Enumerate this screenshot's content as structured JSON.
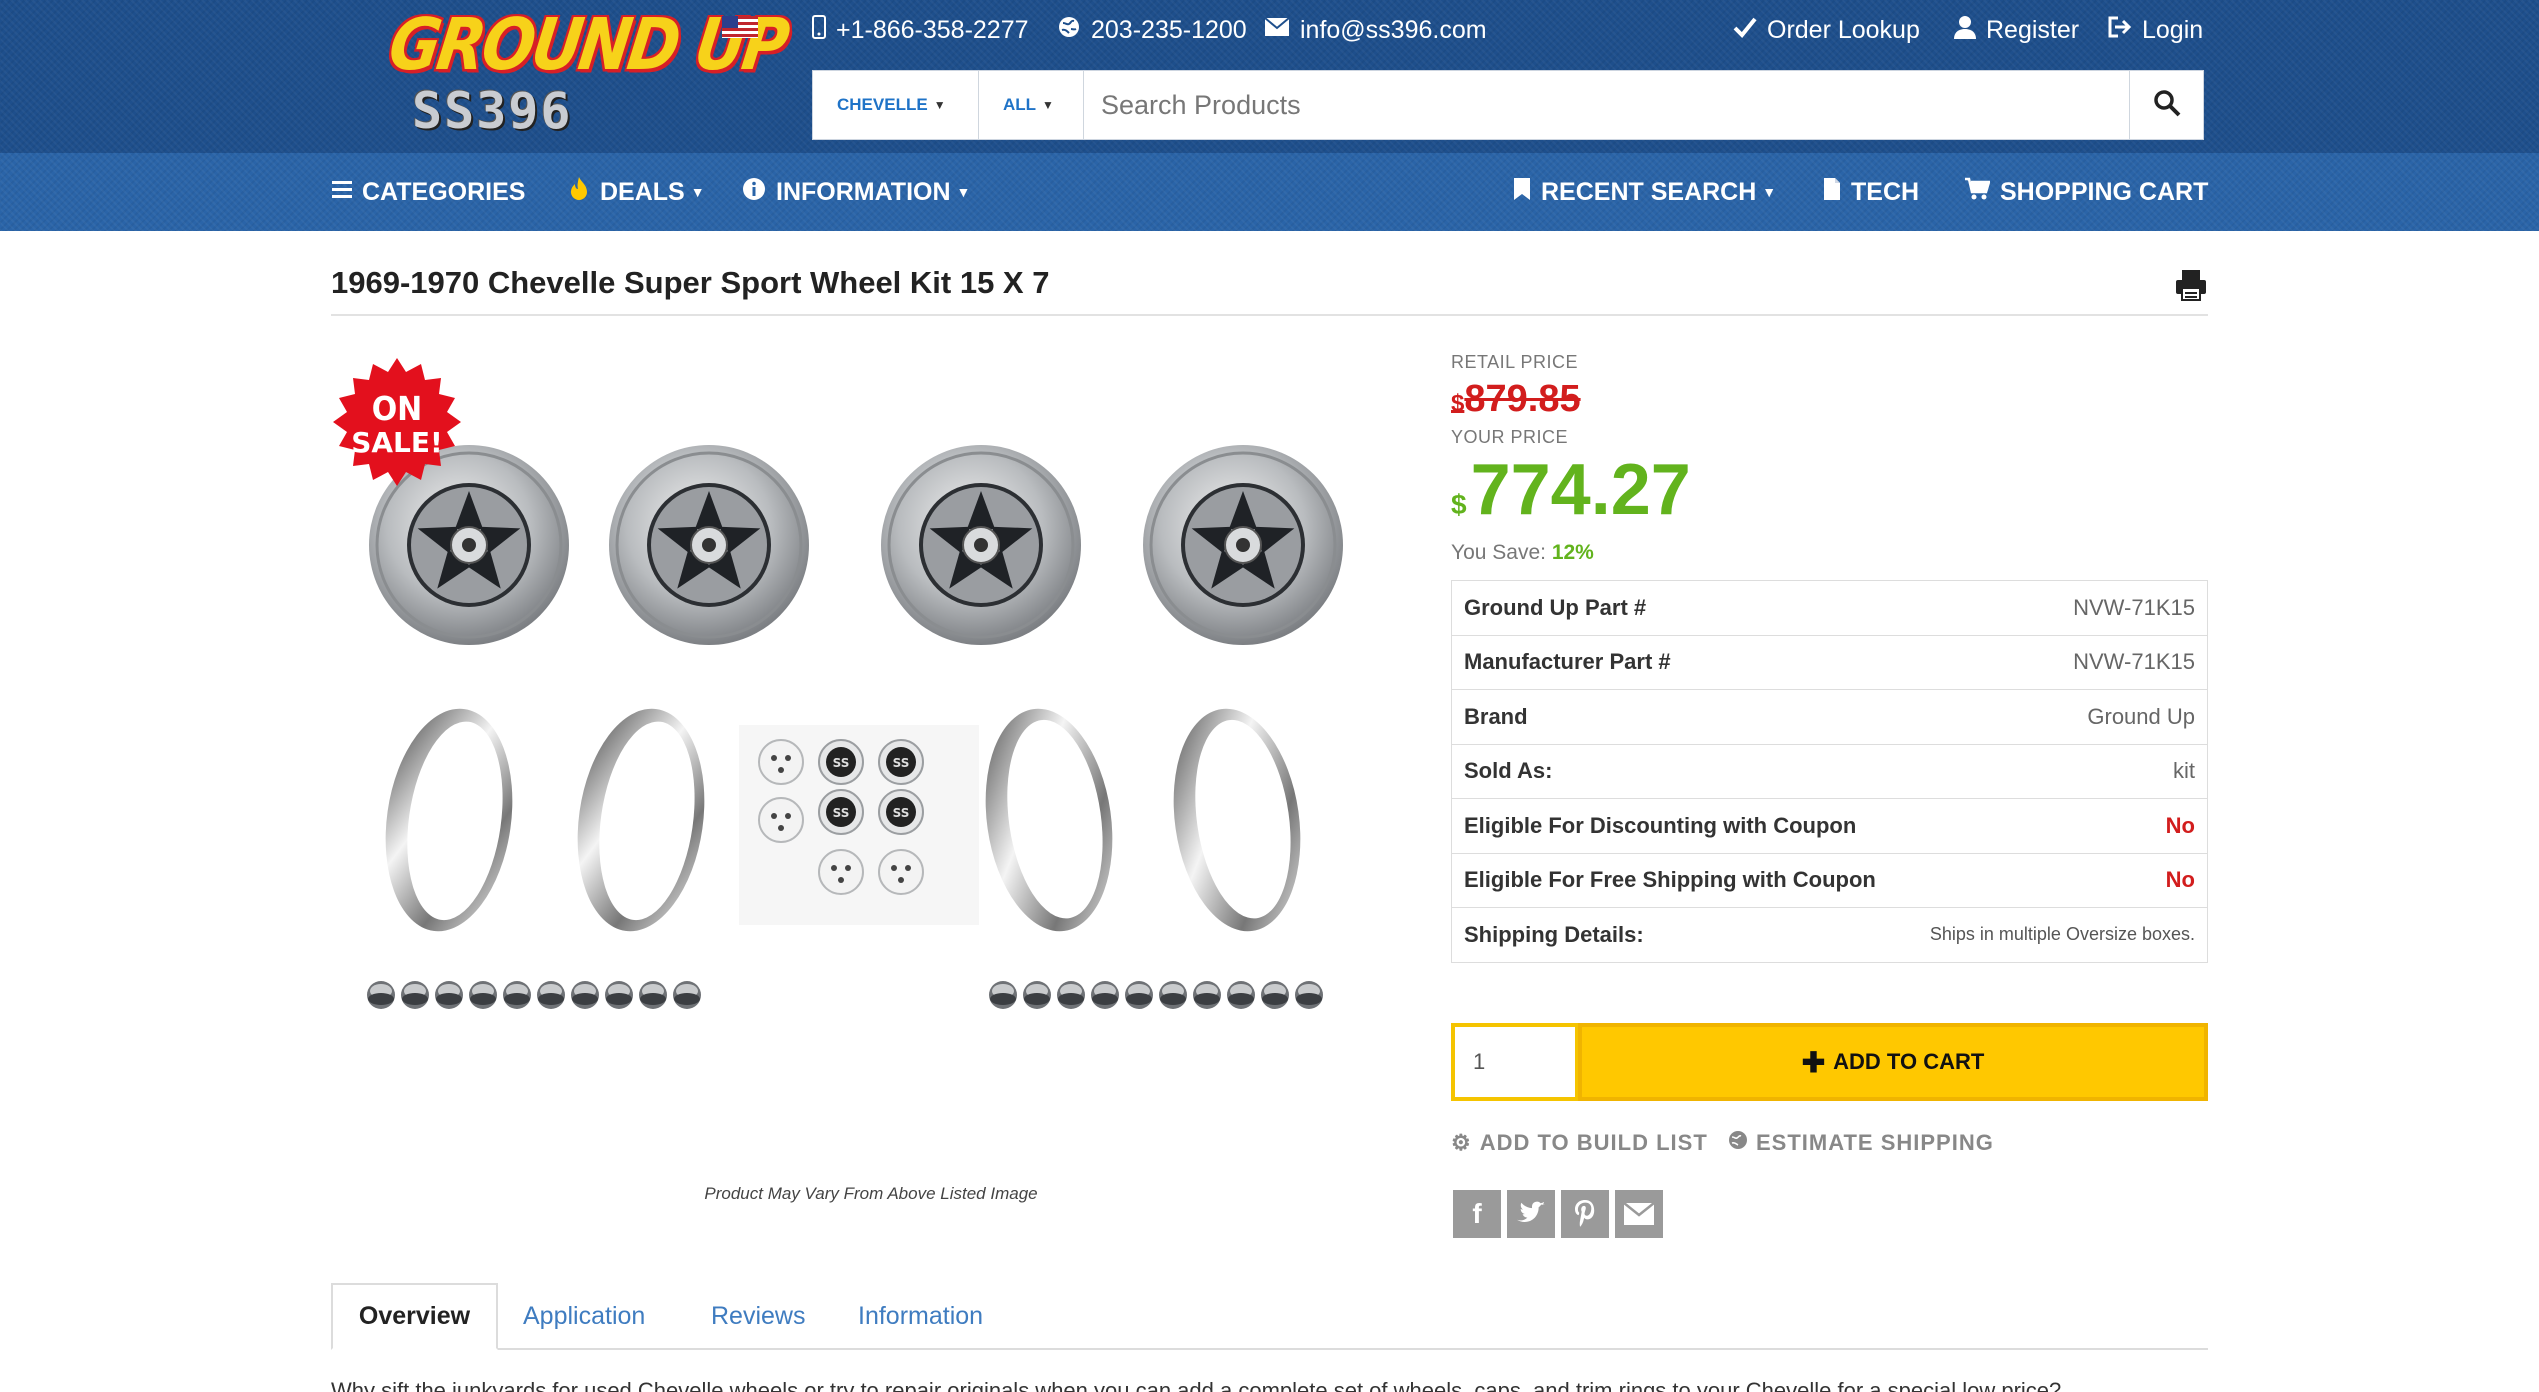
{
  "header": {
    "logo_top": "GROUND UP",
    "logo_bottom": "SS396",
    "phone1": "+1-866-358-2277",
    "phone2": "203-235-1200",
    "email": "info@ss396.com",
    "order_lookup": "Order Lookup",
    "register": "Register",
    "login": "Login"
  },
  "search": {
    "make_label": "CHEVELLE",
    "category_label": "ALL",
    "placeholder": "Search Products"
  },
  "nav": {
    "categories": "CATEGORIES",
    "deals": "DEALS",
    "information": "INFORMATION",
    "recent_search": "RECENT SEARCH",
    "tech": "TECH",
    "shopping_cart": "SHOPPING CART"
  },
  "product": {
    "title": "1969-1970 Chevelle Super Sport Wheel Kit 15 X 7",
    "sale_badge": [
      "ON",
      "SALE!"
    ],
    "image_caption": "Product May Vary From Above Listed Image",
    "retail_label": "RETAIL PRICE",
    "currency_symbol": "$",
    "retail_price": "879.85",
    "your_label": "YOUR PRICE",
    "your_price": "774.27",
    "you_save_label": "You Save:",
    "you_save_value": "12%",
    "center_cap_text": "SS"
  },
  "specs": [
    {
      "key": "Ground Up Part #",
      "value": "NVW-71K15"
    },
    {
      "key": "Manufacturer Part #",
      "value": "NVW-71K15"
    },
    {
      "key": "Brand",
      "value": "Ground Up"
    },
    {
      "key": "Sold As:",
      "value": "kit"
    },
    {
      "key": "Eligible For Discounting with Coupon",
      "value": "No"
    },
    {
      "key": "Eligible For Free Shipping with Coupon",
      "value": "No"
    },
    {
      "key": "Shipping Details:",
      "value": "Ships in multiple Oversize boxes."
    }
  ],
  "cart": {
    "quantity": "1",
    "add_to_cart": "ADD TO CART",
    "add_to_build_list": "ADD TO BUILD LIST",
    "estimate_shipping": "ESTIMATE SHIPPING"
  },
  "share_icons": [
    "facebook-icon",
    "twitter-icon",
    "pinterest-icon",
    "email-icon"
  ],
  "tabs": [
    "Overview",
    "Application",
    "Reviews",
    "Information"
  ],
  "overview_text": "Why sift the junkyards for used Chevelle wheels or try to repair originals when you can add a complete set of wheels, caps, and trim rings to your Chevelle for a special low price?",
  "colors": {
    "header_dark": "#1e4f8c",
    "header_nav": "#2a64a8",
    "sale_red": "#d21d1d",
    "price_green": "#62b31d",
    "cart_yellow": "#ffc800",
    "link_blue": "#3f7cc0"
  }
}
